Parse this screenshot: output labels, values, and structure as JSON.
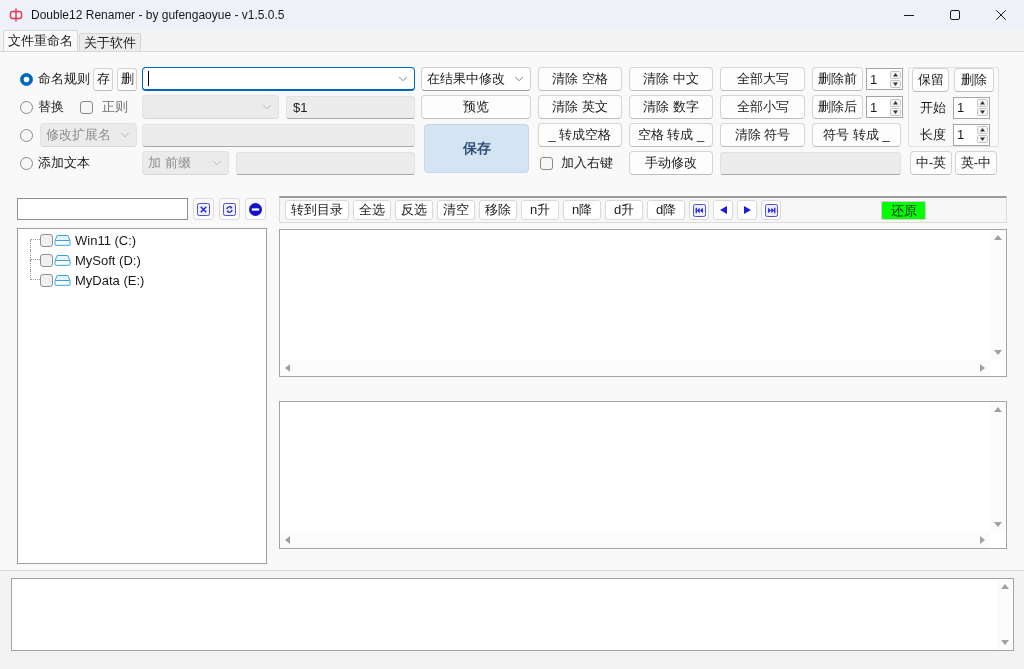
{
  "window": {
    "title": "Double12 Renamer - by gufengaoyue - v1.5.0.5"
  },
  "tabs": [
    {
      "label": "文件重命名",
      "selected": true
    },
    {
      "label": "关于软件",
      "selected": false
    }
  ],
  "mode_rows": [
    {
      "kind": "rule",
      "radio": {
        "label": "命名规则",
        "selected": true
      },
      "buttons": [
        "存",
        "删"
      ],
      "combo": {
        "focused": true
      }
    },
    {
      "kind": "replace",
      "radio": {
        "label": "替换",
        "selected": false
      },
      "regex": {
        "label": "正则",
        "checked": false
      },
      "combo": {
        "disabled": true
      },
      "field": {
        "value": "$1",
        "disabled": true
      }
    },
    {
      "kind": "extension",
      "radio": {
        "selected": false
      },
      "dropdown": {
        "value": "修改扩展名",
        "disabled": true
      },
      "field": {
        "disabled": true
      }
    },
    {
      "kind": "add_text",
      "radio": {
        "label": "添加文本",
        "selected": false
      },
      "dropdown": {
        "value": "加 前缀",
        "disabled": true
      },
      "field": {
        "disabled": true
      }
    }
  ],
  "target_dropdown": {
    "value": "在结果中修改"
  },
  "preview_button": "预览",
  "save_button": "保存",
  "clean_buttons": [
    [
      "清除 空格",
      "清除 中文",
      "全部大写"
    ],
    [
      "清除 英文",
      "清除 数字",
      "全部小写"
    ],
    [
      "_ 转成空格",
      "空格 转成 _",
      "清除 符号"
    ]
  ],
  "trim_spinners": [
    {
      "label": "删除前",
      "value": "1"
    },
    {
      "label": "删除后",
      "value": "1"
    }
  ],
  "symbol_button": "符号 转成 _",
  "keep_group": {
    "buttons": [
      "保留",
      "删除"
    ],
    "spinners": [
      {
        "label": "开始",
        "value": "1"
      },
      {
        "label": "长度",
        "value": "1"
      }
    ]
  },
  "context_menu_option": {
    "label": "加入右键",
    "checked": false
  },
  "manual_button": "手动修改",
  "manual_field": {
    "disabled": true
  },
  "translate_buttons": [
    "中-英",
    "英-中"
  ],
  "drives": [
    {
      "label": "Win11 (C:)",
      "checked": false
    },
    {
      "label": "MySoft (D:)",
      "checked": false
    },
    {
      "label": "MyData (E:)",
      "checked": false
    }
  ],
  "list_toolbar": {
    "buttons": [
      "转到目录",
      "全选",
      "反选",
      "清空",
      "移除",
      "n升",
      "n降",
      "d升",
      "d降"
    ],
    "restore_button": "还原"
  }
}
